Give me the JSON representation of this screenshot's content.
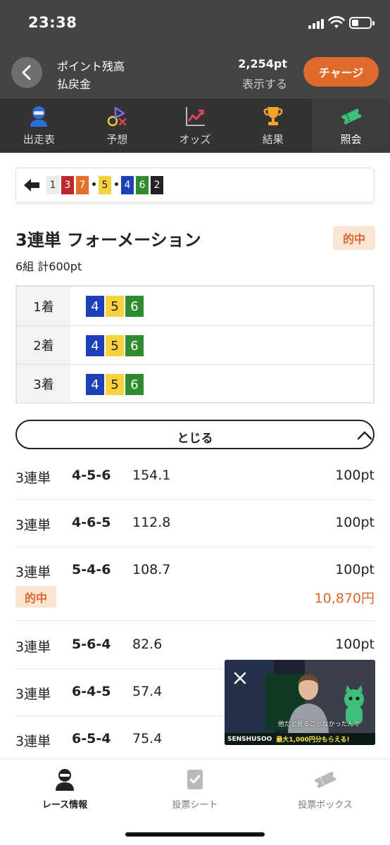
{
  "status_bar": {
    "time": "23:38"
  },
  "header": {
    "label_points": "ポイント残高",
    "label_refund": "払戻金",
    "points": "2,254pt",
    "show_label": "表示する",
    "charge_label": "チャージ"
  },
  "tabs": [
    {
      "label": "出走表",
      "icon": "racer-icon"
    },
    {
      "label": "予想",
      "icon": "prediction-icon"
    },
    {
      "label": "オッズ",
      "icon": "odds-chart-icon"
    },
    {
      "label": "結果",
      "icon": "trophy-icon"
    },
    {
      "label": "照会",
      "icon": "ticket-icon",
      "active": true
    }
  ],
  "combo_bar": {
    "items": [
      {
        "text": "1",
        "bg": "#ececec",
        "fg": "#333333"
      },
      {
        "text": "3",
        "bg": "#c0272d",
        "fg": "#ffffff"
      },
      {
        "text": "7",
        "bg": "#e0702a",
        "fg": "#ffffff"
      },
      {
        "text": "•",
        "dot": true
      },
      {
        "text": "5",
        "bg": "#f7d23e",
        "fg": "#222222"
      },
      {
        "text": "•",
        "dot": true
      },
      {
        "text": "4",
        "bg": "#1d3fb8",
        "fg": "#ffffff"
      },
      {
        "text": "6",
        "bg": "#2e8b2e",
        "fg": "#ffffff"
      },
      {
        "text": "2",
        "bg": "#222222",
        "fg": "#ffffff"
      }
    ]
  },
  "bet": {
    "title": "3連単 フォーメーション",
    "badge": "的中",
    "summary": "6組 計600pt",
    "rows": [
      {
        "place": "1着",
        "numbers": [
          "4",
          "5",
          "6"
        ]
      },
      {
        "place": "2着",
        "numbers": [
          "4",
          "5",
          "6"
        ]
      },
      {
        "place": "3着",
        "numbers": [
          "4",
          "5",
          "6"
        ]
      }
    ],
    "close_label": "とじる"
  },
  "number_colors": {
    "4": {
      "bg": "#1d3fb8",
      "fg": "#ffffff"
    },
    "5": {
      "bg": "#f7d23e",
      "fg": "#222222"
    },
    "6": {
      "bg": "#2e8b2e",
      "fg": "#ffffff"
    }
  },
  "bets": [
    {
      "type": "3連単",
      "combo": "4-5-6",
      "odds": "154.1",
      "amount": "100pt"
    },
    {
      "type": "3連単",
      "combo": "4-6-5",
      "odds": "112.8",
      "amount": "100pt"
    },
    {
      "type": "3連単",
      "combo": "5-4-6",
      "odds": "108.7",
      "amount": "100pt",
      "hit": "的中",
      "payout": "10,870円"
    },
    {
      "type": "3連単",
      "combo": "5-6-4",
      "odds": "82.6",
      "amount": "100pt"
    },
    {
      "type": "3連単",
      "combo": "6-4-5",
      "odds": "57.4",
      "amount": ""
    },
    {
      "type": "3連単",
      "combo": "6-5-4",
      "odds": "75.4",
      "amount": ""
    }
  ],
  "video_pip": {
    "caption": "他だと見ることなかったんで",
    "banner_left": "SENSHUSOO",
    "banner_right": "最大1,000円分もらえる!"
  },
  "bottom_nav": [
    {
      "label": "レース情報",
      "icon": "race-info-icon",
      "active": true
    },
    {
      "label": "投票シート",
      "icon": "vote-sheet-icon"
    },
    {
      "label": "投票ボックス",
      "icon": "vote-box-icon"
    }
  ],
  "colors": {
    "accent": "#e06a2b",
    "header_bg": "#444444",
    "tab_bg": "#333333",
    "hit_bg": "#fbe4d2",
    "hit_fg": "#d9682a"
  }
}
